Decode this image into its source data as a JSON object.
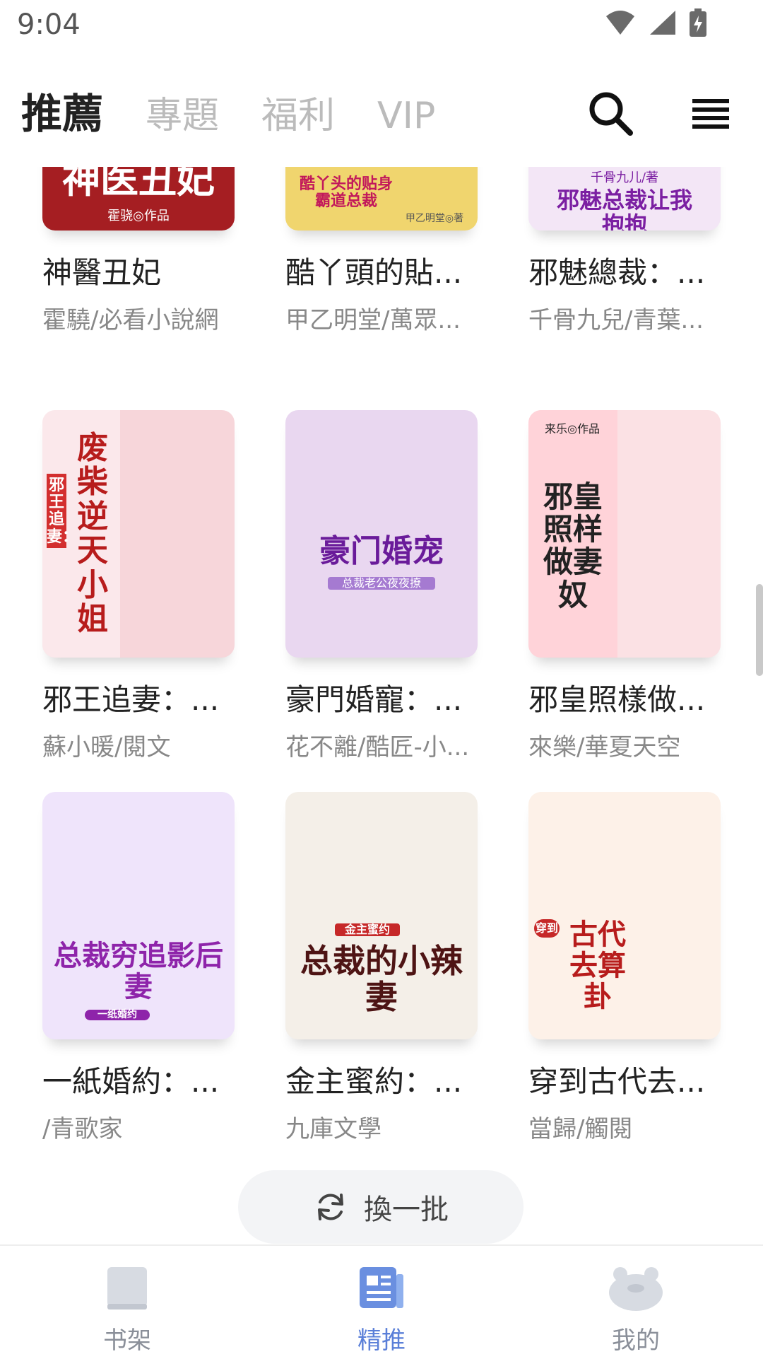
{
  "status_bar": {
    "time": "9:04"
  },
  "header": {
    "tabs": [
      {
        "label": "推薦",
        "active": true
      },
      {
        "label": "專題",
        "active": false
      },
      {
        "label": "福利",
        "active": false
      },
      {
        "label": "VIP",
        "active": false
      }
    ],
    "search_icon": "search-icon",
    "menu_icon": "menu-icon"
  },
  "books": [
    {
      "title": "神醫丑妃",
      "author": "霍驍/必看小說網",
      "cover_text": "神医丑妃",
      "cover_sub": "霍骁◎作品",
      "cover_bg": "#a51e22",
      "cover_fg": "#ffffff"
    },
    {
      "title": "酷丫頭的貼...",
      "author": "甲乙明堂/萬眾...",
      "cover_text": "酷丫头的贴身霸道总裁",
      "cover_sub": "甲乙明堂◎著",
      "cover_bg": "#f0d56e",
      "cover_fg": "#c2185b"
    },
    {
      "title": "邪魅總裁：...",
      "author": "千骨九兒/青葉...",
      "cover_text": "邪魅总裁让我抱抱",
      "cover_sub": "千骨九儿/著",
      "cover_bg": "#f3e6f6",
      "cover_fg": "#7b1fa2"
    },
    {
      "title": "邪王追妻：...",
      "author": "蘇小暖/閱文",
      "cover_text": "废柴逆天小姐",
      "cover_sub": "邪王追妻：",
      "cover_bg": "#f7d6da",
      "cover_fg": "#b71c1c"
    },
    {
      "title": "豪門婚寵：...",
      "author": "花不離/酷匠-小...",
      "cover_text": "豪门婚宠",
      "cover_sub": "总裁老公夜夜撩",
      "cover_bg": "#e9d7f0",
      "cover_fg": "#6a1b9a"
    },
    {
      "title": "邪皇照樣做...",
      "author": "來樂/華夏天空",
      "cover_text": "邪皇照样做妻奴",
      "cover_sub": "来乐◎作品",
      "cover_bg": "#fbe1e4",
      "cover_fg": "#222222"
    },
    {
      "title": "一紙婚約：...",
      "author": "/青歌家",
      "cover_text": "总裁穷追影后妻",
      "cover_sub": "一纸婚约",
      "cover_bg": "#efe4fb",
      "cover_fg": "#8e24aa"
    },
    {
      "title": "金主蜜約：...",
      "author": "九庫文學",
      "cover_text": "总裁的小辣妻",
      "cover_sub": "金主蜜约",
      "cover_bg": "#f4efe8",
      "cover_fg": "#4e1414"
    },
    {
      "title": "穿到古代去...",
      "author": "當歸/觸閱",
      "cover_text": "古代去算卦",
      "cover_sub": "穿到",
      "cover_bg": "#fdf1e8",
      "cover_fg": "#b71c1c"
    }
  ],
  "refresh_button": {
    "label": "換一批",
    "icon": "refresh-icon"
  },
  "bottom_nav": [
    {
      "label": "书架",
      "icon": "bookshelf-icon",
      "active": false
    },
    {
      "label": "精推",
      "icon": "featured-icon",
      "active": true
    },
    {
      "label": "我的",
      "icon": "profile-icon",
      "active": false
    }
  ],
  "colors": {
    "accent": "#5a7fd8",
    "nav_inactive": "#8a8f99",
    "tab_inactive": "#bbbbbb"
  }
}
